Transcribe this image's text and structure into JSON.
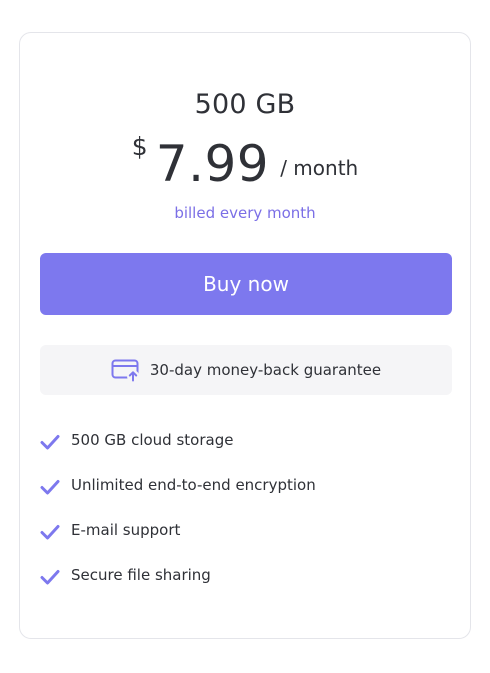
{
  "plan": {
    "name": "500 GB",
    "currency": "$",
    "amount": "7.99",
    "period": "/ month",
    "billing": "billed every month"
  },
  "actions": {
    "buy_label": "Buy now"
  },
  "guarantee": {
    "icon": "card-refund-icon",
    "text": "30-day money-back guarantee"
  },
  "features": [
    "500 GB cloud storage",
    "Unlimited end-to-end encryption",
    "E-mail support",
    "Secure file sharing"
  ],
  "colors": {
    "accent": "#7d78ee",
    "billing_text": "#7b6fe6",
    "text": "#2f3137",
    "guarantee_bg": "#f5f5f7"
  }
}
